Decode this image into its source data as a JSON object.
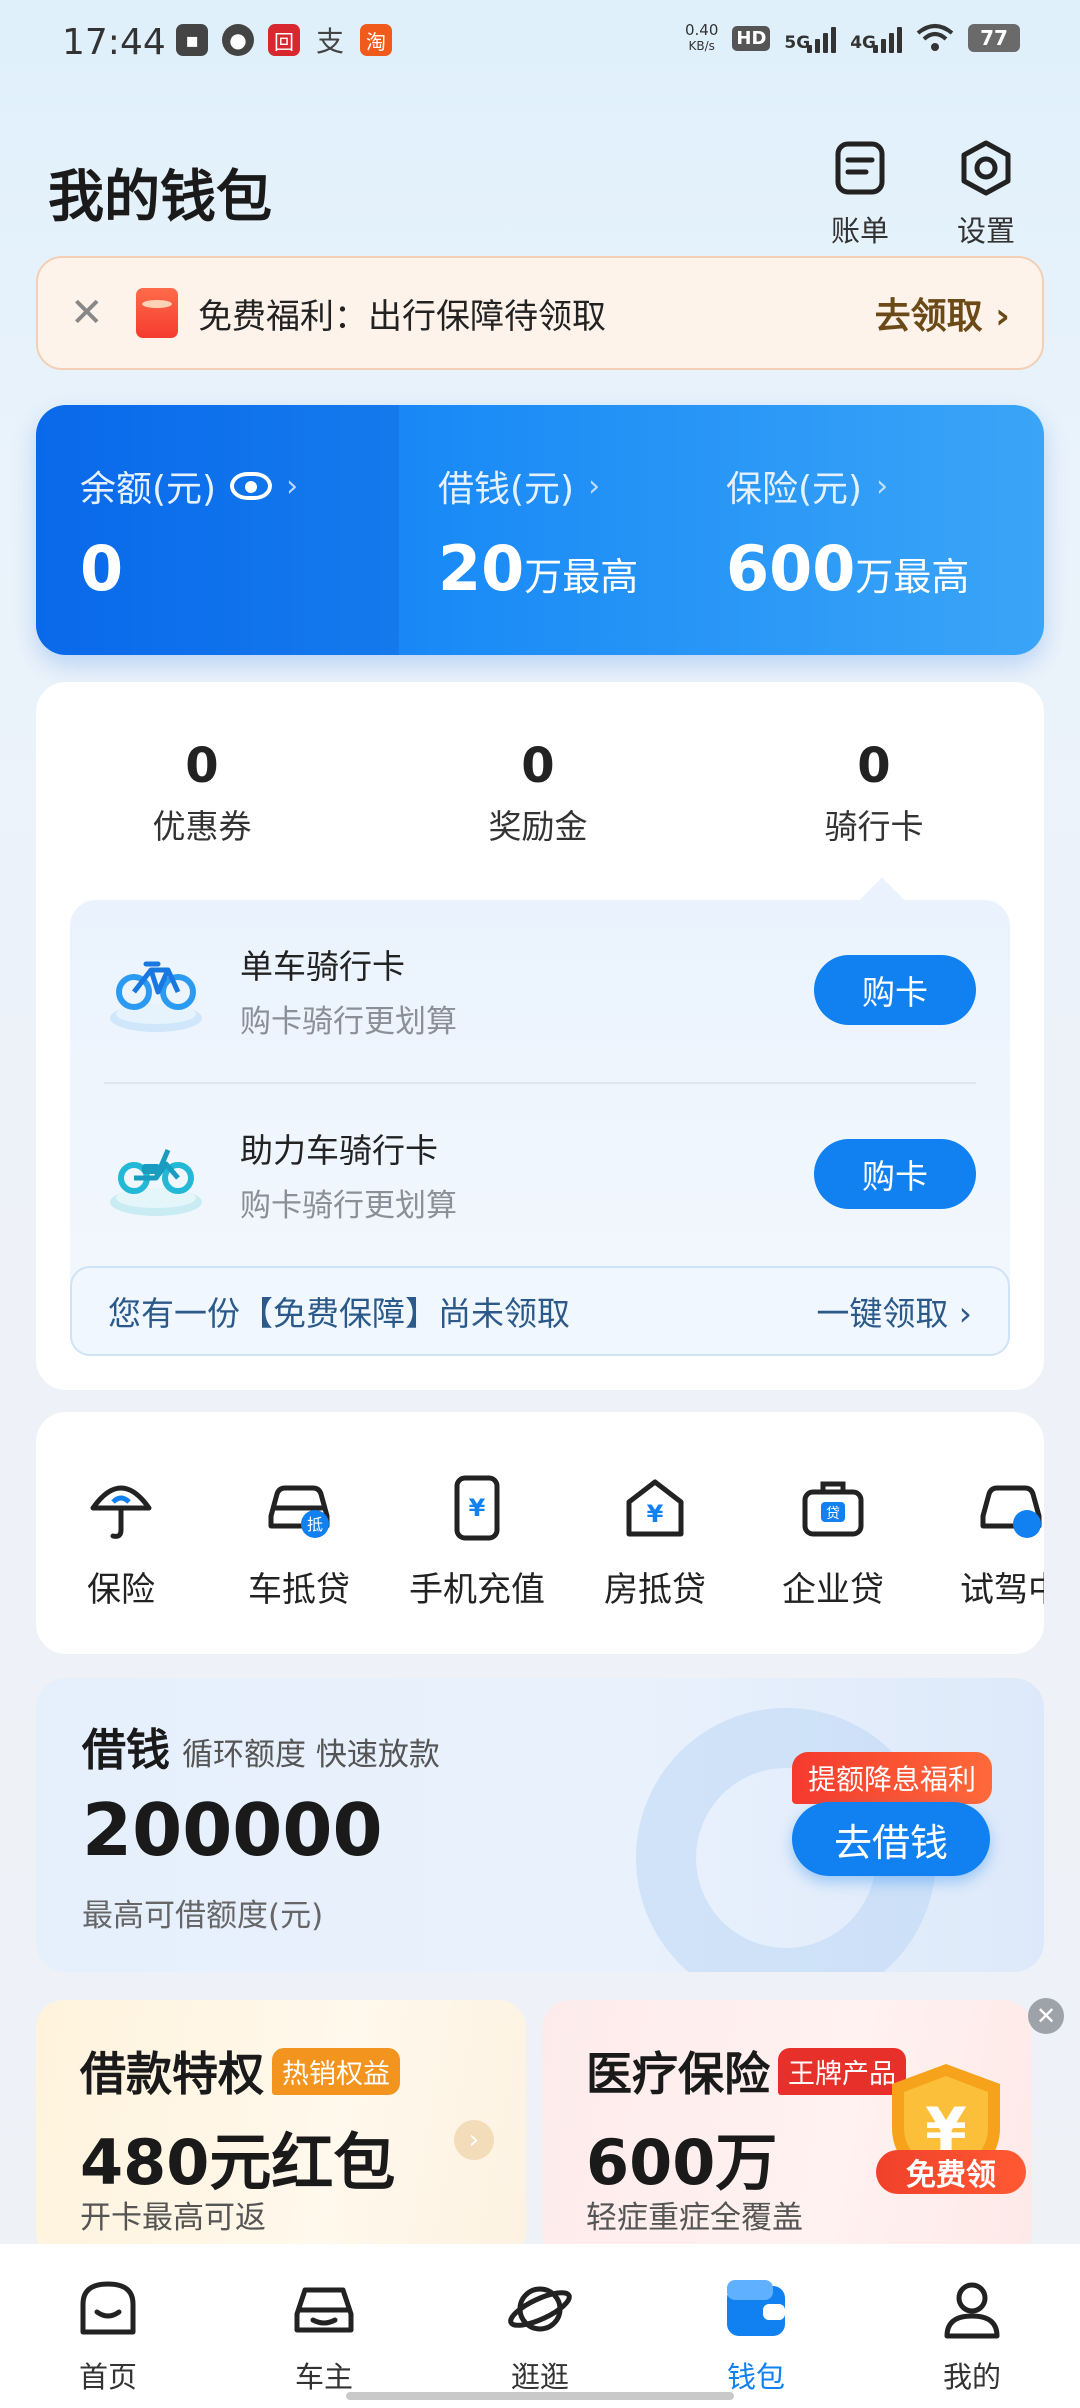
{
  "status_bar": {
    "time": "17:44",
    "left_icons": [
      "app-icon",
      "message-icon",
      "bank-icon",
      "alipay-icon",
      "taobao-icon"
    ],
    "left_glyphs": [
      "▪",
      "●",
      "回",
      "支",
      "淘"
    ],
    "net_speed_value": "0.40",
    "net_speed_unit": "KB/s",
    "hd": "HD",
    "sig1_label": "5G",
    "sig2_label": "4G",
    "battery": "77"
  },
  "header": {
    "title": "我的钱包",
    "bill_label": "账单",
    "settings_label": "设置"
  },
  "promo_banner": {
    "close": "✕",
    "text": "免费福利：出行保障待领取",
    "action": "去领取 ›"
  },
  "balance_card": {
    "balance_label": "余额(元)",
    "balance_value": "0",
    "borrow_label": "借钱(元)",
    "borrow_value": "20",
    "borrow_unit": "万最高",
    "insurance_label": "保险(元)",
    "insurance_value": "600",
    "insurance_unit": "万最高",
    "chevron": "›"
  },
  "stats": [
    {
      "num": "0",
      "label": "优惠券"
    },
    {
      "num": "0",
      "label": "奖励金"
    },
    {
      "num": "0",
      "label": "骑行卡"
    }
  ],
  "ride_cards": [
    {
      "title": "单车骑行卡",
      "subtitle": "购卡骑行更划算",
      "button": "购卡"
    },
    {
      "title": "助力车骑行卡",
      "subtitle": "购卡骑行更划算",
      "button": "购卡"
    }
  ],
  "free_guarantee": {
    "text": "您有一份【免费保障】尚未领取",
    "action": "一键领取 ›"
  },
  "services": [
    {
      "label": "保险",
      "icon": "umbrella-icon"
    },
    {
      "label": "车抵贷",
      "icon": "car-loan-icon"
    },
    {
      "label": "手机充值",
      "icon": "phone-recharge-icon"
    },
    {
      "label": "房抵贷",
      "icon": "house-loan-icon"
    },
    {
      "label": "企业贷",
      "icon": "business-loan-icon"
    },
    {
      "label": "试驾中",
      "icon": "test-drive-icon"
    }
  ],
  "loan": {
    "title": "借钱",
    "subtitle": "循环额度 快速放款",
    "amount": "200000",
    "desc": "最高可借额度(元)",
    "tag": "提额降息福利",
    "button": "去借钱"
  },
  "promo_cards": [
    {
      "title": "借款特权",
      "tag": "热销权益",
      "big": "480元红包",
      "sub": "开卡最高可返",
      "tag_color": "#f3941e"
    },
    {
      "title": "医疗保险",
      "tag": "王牌产品",
      "big": "600万",
      "sub": "轻症重症全覆盖",
      "tag_color": "#e8302a",
      "badge": "免费领",
      "shield_glyph": "¥"
    }
  ],
  "promo_close": "✕",
  "promo_arrow": "›",
  "bottom_nav": [
    {
      "label": "首页",
      "icon": "home-icon"
    },
    {
      "label": "车主",
      "icon": "car-icon"
    },
    {
      "label": "逛逛",
      "icon": "planet-icon"
    },
    {
      "label": "钱包",
      "icon": "wallet-icon",
      "active": true
    },
    {
      "label": "我的",
      "icon": "profile-icon"
    }
  ],
  "colors": {
    "accent": "#1180f1",
    "banner_action": "#6b4a18",
    "red_tag": "#f53a2d"
  }
}
